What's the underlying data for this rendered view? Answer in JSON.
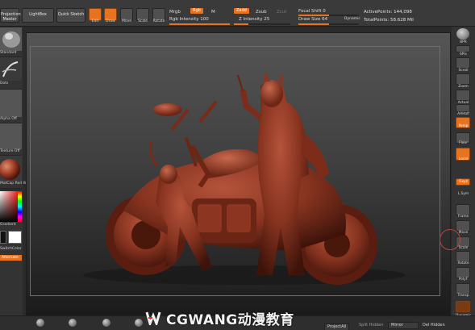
{
  "toolbar": {
    "projection_master_label": "Projection Master",
    "lightbox_label": "LightBox",
    "quick_sketch_label": "Quick Sketch",
    "edit_label": "Edit",
    "draw_label": "Draw",
    "move_label": "Move",
    "scale_label": "Scale",
    "rotate_label": "Rotate",
    "mrgb_label": "Mrgb",
    "rgb_label": "Rgb",
    "m_label": "M",
    "rgb_intensity_label": "Rgb Intensity 100",
    "zadd_label": "Zadd",
    "zsub_label": "Zsub",
    "zcut_label": "Zcut",
    "z_intensity_label": "Z Intensity 25",
    "focal_shift_label": "Focal Shift 0",
    "draw_size_label": "Draw Size 64",
    "dynamic_label": "Dynamic",
    "active_points": "ActivePoints: 144,098",
    "total_points": "TotalPoints: 58.628 Mil",
    "rgb_intensity_value": 100,
    "z_intensity_value": 25,
    "draw_size_value": 64,
    "accent_color": "#e8731f"
  },
  "left_shelf": {
    "labels": [
      "Standard",
      "Dots",
      "Alpha Off",
      "Texture Off",
      "MatCap Red Wax",
      "Gradient",
      "SwitchColor",
      "Alternate"
    ],
    "accent_color": "#e8731f"
  },
  "right_shelf": {
    "items": [
      "BPR",
      "SPix",
      "Scroll",
      "Zoom",
      "Actual",
      "AAHalf",
      "Persp",
      "Floor",
      "Local",
      "Gxyz",
      "L.Sym",
      "Frame",
      "Move",
      "Scale",
      "Rotate",
      "PolyF",
      "Transp",
      "Dynamic"
    ]
  },
  "bottom": {
    "project_all_label": "ProjectAll",
    "split_hidden_label": "Split Hidden",
    "mirror_label": "Mirror",
    "del_hidden_label": "Del Hidden"
  },
  "watermark": {
    "text": "CGWANG动漫教育"
  }
}
